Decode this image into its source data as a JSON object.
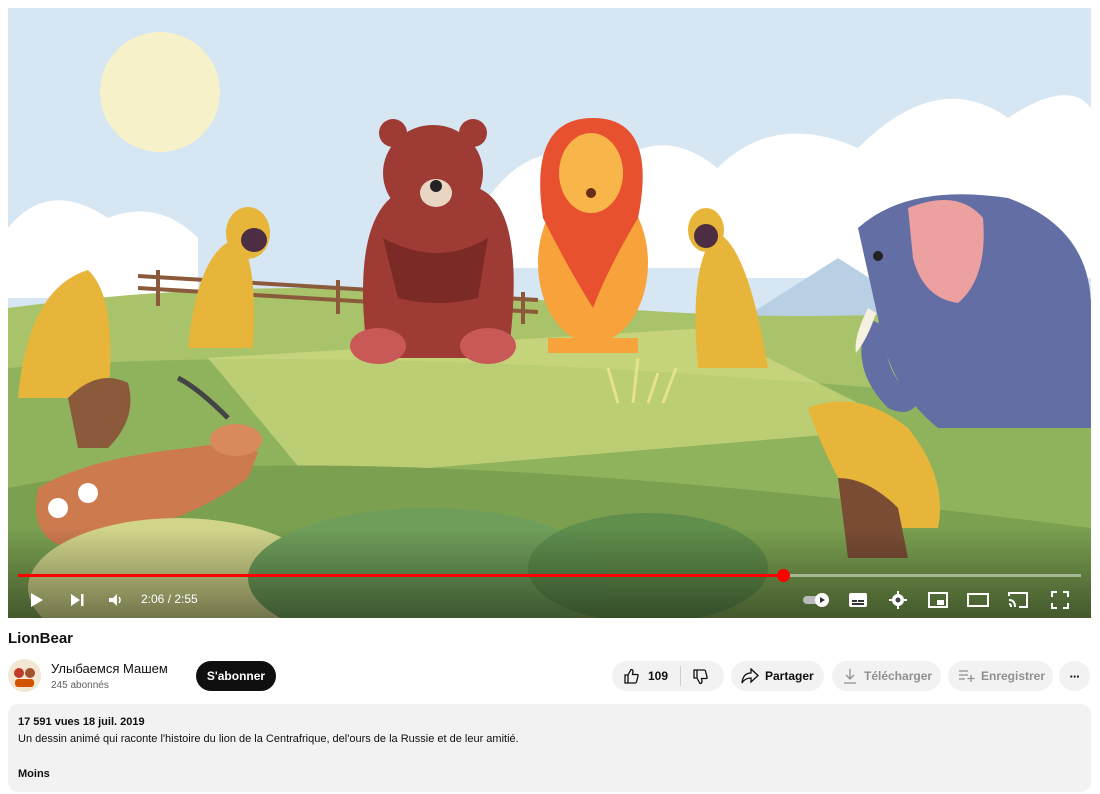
{
  "video": {
    "title": "LionBear",
    "time_current": "2:06",
    "time_total": "2:55",
    "time_display": "2:06 / 2:55",
    "progress": 0.72
  },
  "channel": {
    "name": "Улыбаемся Машем",
    "subscribers": "245 abonnés",
    "subscribe_label": "S'abonner"
  },
  "actions": {
    "likes": "109",
    "share_label": "Partager",
    "download_label": "Télécharger",
    "save_label": "Enregistrer",
    "more_label": "···"
  },
  "description": {
    "meta": "17 591 vues  18 juil. 2019",
    "text": "Un dessin animé qui raconte l'histoire du lion de la Centrafrique, del'ours de la Russie et de leur amitié.",
    "less_label": "Moins"
  },
  "colors": {
    "progress": "#ff0000",
    "subscribe_bg": "#0f0f0f",
    "pill_bg": "#f2f2f2"
  },
  "icons": {
    "play": "play-icon",
    "next": "next-icon",
    "volume": "volume-icon",
    "autoplay": "autoplay-toggle-icon",
    "subtitles": "subtitles-icon",
    "settings": "gear-icon",
    "miniplayer": "miniplayer-icon",
    "theater": "theater-icon",
    "cast": "cast-icon",
    "fullscreen": "fullscreen-icon",
    "like": "thumbs-up-icon",
    "dislike": "thumbs-down-icon",
    "share": "share-arrow-icon",
    "download": "download-icon",
    "save": "add-to-playlist-icon"
  }
}
